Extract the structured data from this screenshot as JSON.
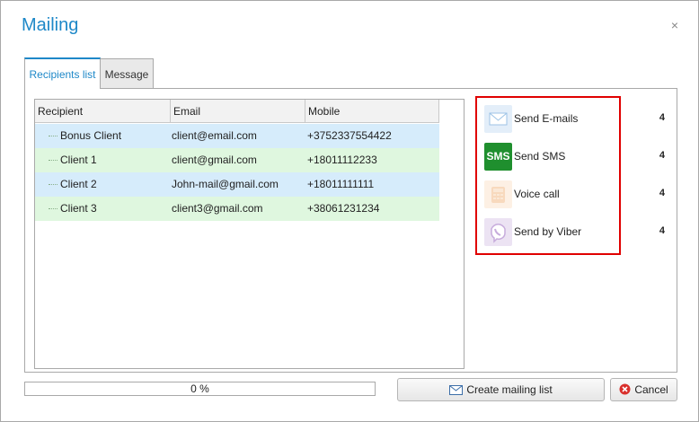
{
  "window": {
    "title": "Mailing",
    "close_glyph": "×"
  },
  "tabs": [
    {
      "label": "Recipients list",
      "active": true
    },
    {
      "label": "Message",
      "active": false
    }
  ],
  "grid": {
    "columns": [
      "Recipient",
      "Email",
      "Mobile"
    ],
    "rows": [
      {
        "recipient": "Bonus Client",
        "email": "client@email.com",
        "mobile": "+3752337554422",
        "color": "#d6ecfb"
      },
      {
        "recipient": "Client 1",
        "email": "client@gmail.com",
        "mobile": "+18011112233",
        "color": "#dff7df"
      },
      {
        "recipient": "Client 2",
        "email": "John-mail@gmail.com",
        "mobile": "+18011111111",
        "color": "#d6ecfb"
      },
      {
        "recipient": "Client 3",
        "email": "client3@gmail.com",
        "mobile": "+38061231234",
        "color": "#dff7df"
      }
    ]
  },
  "actions": [
    {
      "label": "Send E-mails",
      "count": "4",
      "icon": "envelope-icon"
    },
    {
      "label": "Send SMS",
      "count": "4",
      "icon": "sms-icon",
      "icon_text": "SMS"
    },
    {
      "label": "Voice call",
      "count": "4",
      "icon": "phone-icon"
    },
    {
      "label": "Send by Viber",
      "count": "4",
      "icon": "viber-icon"
    }
  ],
  "progress": {
    "text": "0 %",
    "value": 0
  },
  "buttons": {
    "create": "Create mailing list",
    "cancel": "Cancel"
  },
  "colors": {
    "accent": "#1e88c8",
    "highlight_border": "#e00000",
    "sms_green": "#1f8f2e"
  }
}
